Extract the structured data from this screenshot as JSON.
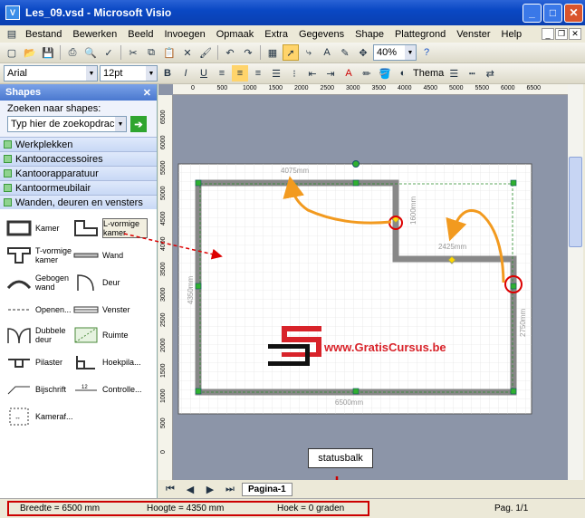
{
  "window": {
    "title": "Les_09.vsd - Microsoft Visio"
  },
  "menu": [
    "Bestand",
    "Bewerken",
    "Beeld",
    "Invoegen",
    "Opmaak",
    "Extra",
    "Gegevens",
    "Shape",
    "Plattegrond",
    "Venster",
    "Help"
  ],
  "toolbar": {
    "zoom": "40%",
    "font": "Arial",
    "font_size": "12pt",
    "theme_label": "Thema"
  },
  "shapes_panel": {
    "title": "Shapes",
    "search_label": "Zoeken naar shapes:",
    "search_placeholder": "Typ hier de zoekopdracht",
    "stencils": [
      "Werkplekken",
      "Kantooraccessoires",
      "Kantoorapparatuur",
      "Kantoormeubilair",
      "Wanden, deuren en vensters"
    ],
    "shapes": [
      "Kamer",
      "L-vormige kamer",
      "T-vormige kamer",
      "Wand",
      "Gebogen wand",
      "Deur",
      "Openen...",
      "Venster",
      "Dubbele deur",
      "Ruimte",
      "Pilaster",
      "Hoekpila...",
      "Bijschrift",
      "Controlle...",
      "Kameraf..."
    ]
  },
  "rulers": {
    "horizontal": [
      "0",
      "500",
      "1000",
      "1500",
      "2000",
      "2500",
      "3000",
      "3500",
      "4000",
      "4500",
      "5000",
      "5500",
      "6000",
      "6500"
    ],
    "vertical": [
      "6500",
      "6000",
      "5500",
      "5000",
      "4500",
      "4000",
      "3500",
      "3000",
      "2500",
      "2000",
      "1500",
      "1000",
      "500",
      "0"
    ]
  },
  "drawing": {
    "dim_top": "4075mm",
    "dim_mid": "2425mm",
    "dim_right_top": "1600mm",
    "dim_left": "4350mm",
    "dim_right": "2750mm",
    "dim_bottom": "6500mm",
    "watermark": "www.GratisCursus.be"
  },
  "page_tab": "Pagina-1",
  "callout": "statusbalk",
  "status": {
    "width": "Breedte = 6500 mm",
    "height": "Hoogte = 4350 mm",
    "angle": "Hoek = 0 graden",
    "page": "Pag. 1/1"
  },
  "colors": {
    "annotation": "#f29a1f",
    "statusbox": "#cc0000",
    "logo_red": "#d8232a"
  }
}
